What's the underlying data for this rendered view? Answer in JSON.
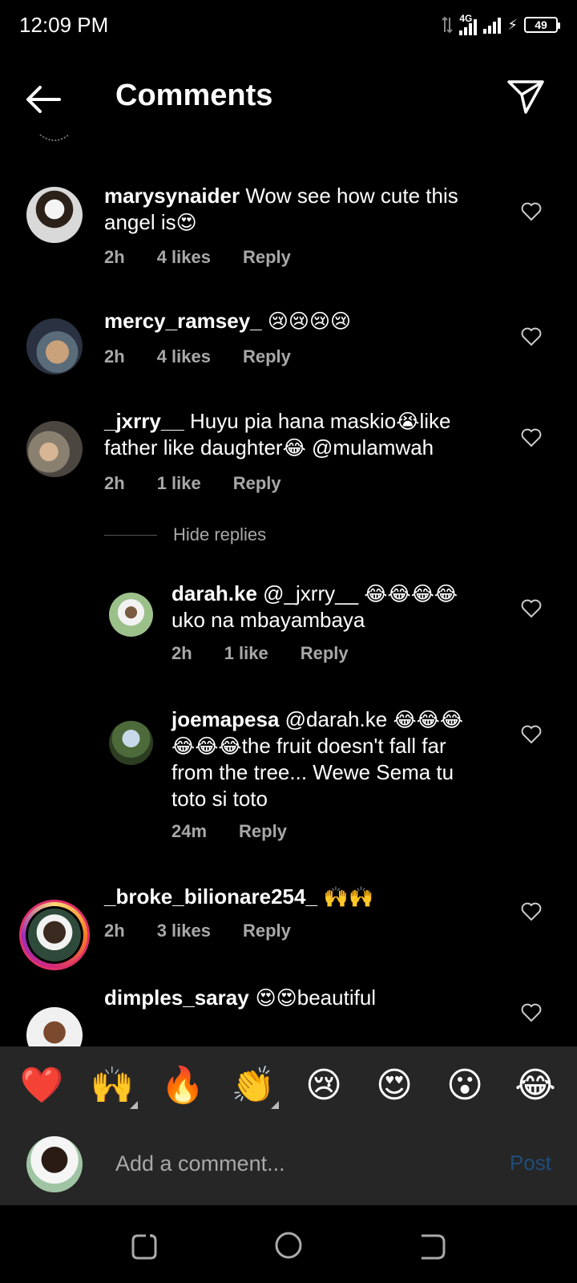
{
  "status": {
    "time": "12:09 PM",
    "network": "4G",
    "battery": "49"
  },
  "header": {
    "title": "Comments"
  },
  "comments": [
    {
      "username": "marysynaider",
      "text": " Wow see how cute this angel is",
      "emoji": "😍",
      "time": "2h",
      "likes": "4 likes",
      "reply": "Reply"
    },
    {
      "username": "mercy_ramsey_",
      "text": " ",
      "emoji": "😢😢😢😢",
      "time": "2h",
      "likes": "4 likes",
      "reply": "Reply"
    },
    {
      "username": "_jxrry__",
      "text_parts": [
        " Huyu pia hana maskio",
        "😭",
        "like father like daughter",
        "😂",
        " @mulamwah"
      ],
      "time": "2h",
      "likes": "1 like",
      "reply": "Reply"
    }
  ],
  "hide_replies": "Hide replies",
  "replies": [
    {
      "username": "darah.ke",
      "text_parts": [
        " @_jxrry__ ",
        "😂😂😂😂",
        " uko na mbayambaya"
      ],
      "time": "2h",
      "likes": "1 like",
      "reply": "Reply"
    },
    {
      "username": "joemapesa",
      "text_parts": [
        " @darah.ke ",
        "😂😂😂😂😂😂",
        "the fruit doesn't fall far from the tree... Wewe Sema tu toto si toto"
      ],
      "time": "24m",
      "reply": "Reply"
    }
  ],
  "more_comments": [
    {
      "username": "_broke_bilionare254_",
      "emoji": " 🙌🙌",
      "time": "2h",
      "likes": "3 likes",
      "reply": "Reply"
    },
    {
      "username": "dimples_saray",
      "emoji": " 😍😍",
      "text": "beautiful"
    }
  ],
  "emoji_bar": [
    "❤️",
    "🙌",
    "🔥",
    "👏",
    "😢",
    "😍",
    "😮",
    "😂"
  ],
  "input": {
    "placeholder": "Add a comment...",
    "post_label": "Post"
  },
  "colors": {
    "background": "#000000",
    "panel": "#262626",
    "muted_text": "#a8a8a8",
    "post_disabled": "#1f4d7a",
    "story_ring": "#e1306c"
  }
}
